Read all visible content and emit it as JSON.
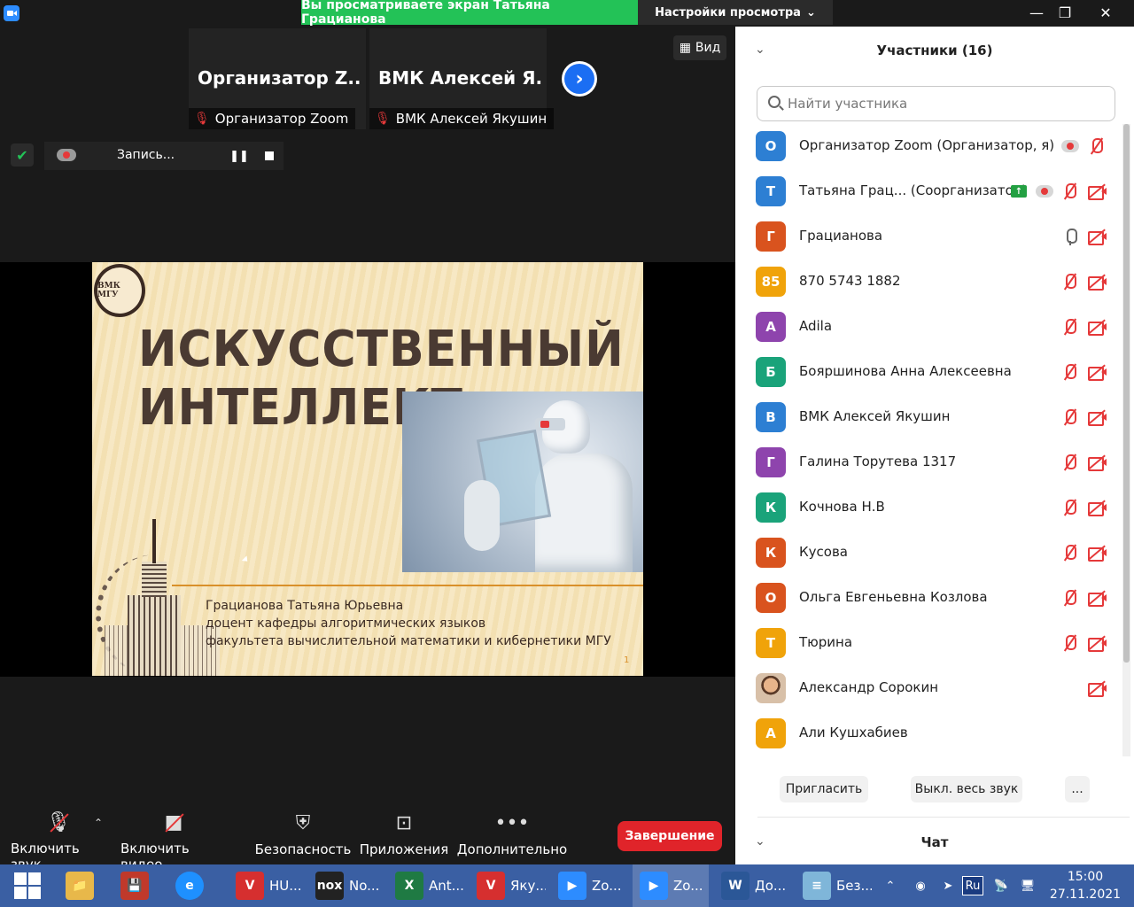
{
  "window": {
    "share_banner": "Вы просматриваете экран Татьяна Грацианова",
    "view_settings": "Настройки просмотра"
  },
  "videos": [
    {
      "big_name": "Организатор Z...",
      "caption": "Организатор Zoom"
    },
    {
      "big_name": "ВМК Алексей Я...",
      "caption": "ВМК Алексей Якушин"
    }
  ],
  "view_button": "Вид",
  "recording": {
    "label": "Запись..."
  },
  "slide": {
    "logo_text": "ВМК МГУ",
    "title_line1": "ИСКУССТВЕННЫЙ",
    "title_line2": "ИНТЕЛЛЕКТ",
    "author_line1": "Грацианова Татьяна Юрьевна",
    "author_line2": "доцент кафедры алгоритмических языков",
    "author_line3": "факультета вычислительной математики и кибернетики МГУ",
    "page_number": "1"
  },
  "toolbar": {
    "audio": "Включить звук",
    "video": "Включить видео",
    "security": "Безопасность",
    "apps": "Приложения",
    "more": "Дополнительно",
    "end": "Завершение"
  },
  "participants": {
    "title": "Участники (16)",
    "search_placeholder": "Найти участника",
    "list": [
      {
        "initial": "О",
        "color": "#2d7fd3",
        "name": "Организатор Zoom (Организатор, я)",
        "icons": [
          "rec",
          "mic-off"
        ]
      },
      {
        "initial": "Т",
        "color": "#2d7fd3",
        "name": "Татьяна Грац...  (Соорганизатор)",
        "icons": [
          "share",
          "rec",
          "mic-off",
          "cam-off"
        ]
      },
      {
        "initial": "Г",
        "color": "#d9531e",
        "name": "Грацианова",
        "icons": [
          "mic-on",
          "cam-off"
        ]
      },
      {
        "initial": "85",
        "color": "#f0a30a",
        "name": "870 5743 1882",
        "icons": [
          "mic-off",
          "cam-off"
        ]
      },
      {
        "initial": "A",
        "color": "#8e44ad",
        "name": "Adila",
        "icons": [
          "mic-off",
          "cam-off"
        ]
      },
      {
        "initial": "Б",
        "color": "#1aa37a",
        "name": "Бояршинова Анна Алексеевна",
        "icons": [
          "mic-off",
          "cam-off"
        ]
      },
      {
        "initial": "В",
        "color": "#2d7fd3",
        "name": "ВМК Алексей Якушин",
        "icons": [
          "mic-off",
          "cam-off"
        ]
      },
      {
        "initial": "Г",
        "color": "#8e44ad",
        "name": "Галина Торутева 1317",
        "icons": [
          "mic-off",
          "cam-off"
        ]
      },
      {
        "initial": "К",
        "color": "#1aa37a",
        "name": "Кочнова Н.В",
        "icons": [
          "mic-off",
          "cam-off"
        ]
      },
      {
        "initial": "К",
        "color": "#d9531e",
        "name": "Кусова",
        "icons": [
          "mic-off",
          "cam-off"
        ]
      },
      {
        "initial": "О",
        "color": "#d9531e",
        "name": "Ольга Евгеньевна Козлова",
        "icons": [
          "mic-off",
          "cam-off"
        ]
      },
      {
        "initial": "Т",
        "color": "#f0a30a",
        "name": "Тюрина",
        "icons": [
          "mic-off",
          "cam-off"
        ]
      },
      {
        "initial": "",
        "color": "photo",
        "name": "Александр Сорокин",
        "icons": [
          "cam-off"
        ]
      },
      {
        "initial": "А",
        "color": "#f0a30a",
        "name": "Али Кушхабиев",
        "icons": []
      }
    ],
    "invite": "Пригласить",
    "mute_all": "Выкл. весь звук",
    "more": "..."
  },
  "chat": {
    "title": "Чат"
  },
  "taskbar": {
    "items": [
      {
        "label": "HU...",
        "icon": "vivaldi-icon",
        "color": "#d62f2f",
        "glyph": "V"
      },
      {
        "label": "No...",
        "icon": "nox-icon",
        "color": "#222222",
        "glyph": "nox"
      },
      {
        "label": "Ant...",
        "icon": "excel-icon",
        "color": "#1f7a43",
        "glyph": "X"
      },
      {
        "label": "Яку...",
        "icon": "vivaldi-icon",
        "color": "#d62f2f",
        "glyph": "V"
      },
      {
        "label": "Zo...",
        "icon": "zoom-icon",
        "color": "#2d8cff",
        "glyph": "▶"
      },
      {
        "label": "Zo...",
        "icon": "zoom-icon",
        "color": "#2d8cff",
        "glyph": "▶"
      },
      {
        "label": "До...",
        "icon": "word-icon",
        "color": "#2b5797",
        "glyph": "W"
      },
      {
        "label": "Без...",
        "icon": "notepad-icon",
        "color": "#7fb6d9",
        "glyph": "≡"
      }
    ],
    "lang": "Ru",
    "time": "15:00",
    "date": "27.11.2021"
  }
}
